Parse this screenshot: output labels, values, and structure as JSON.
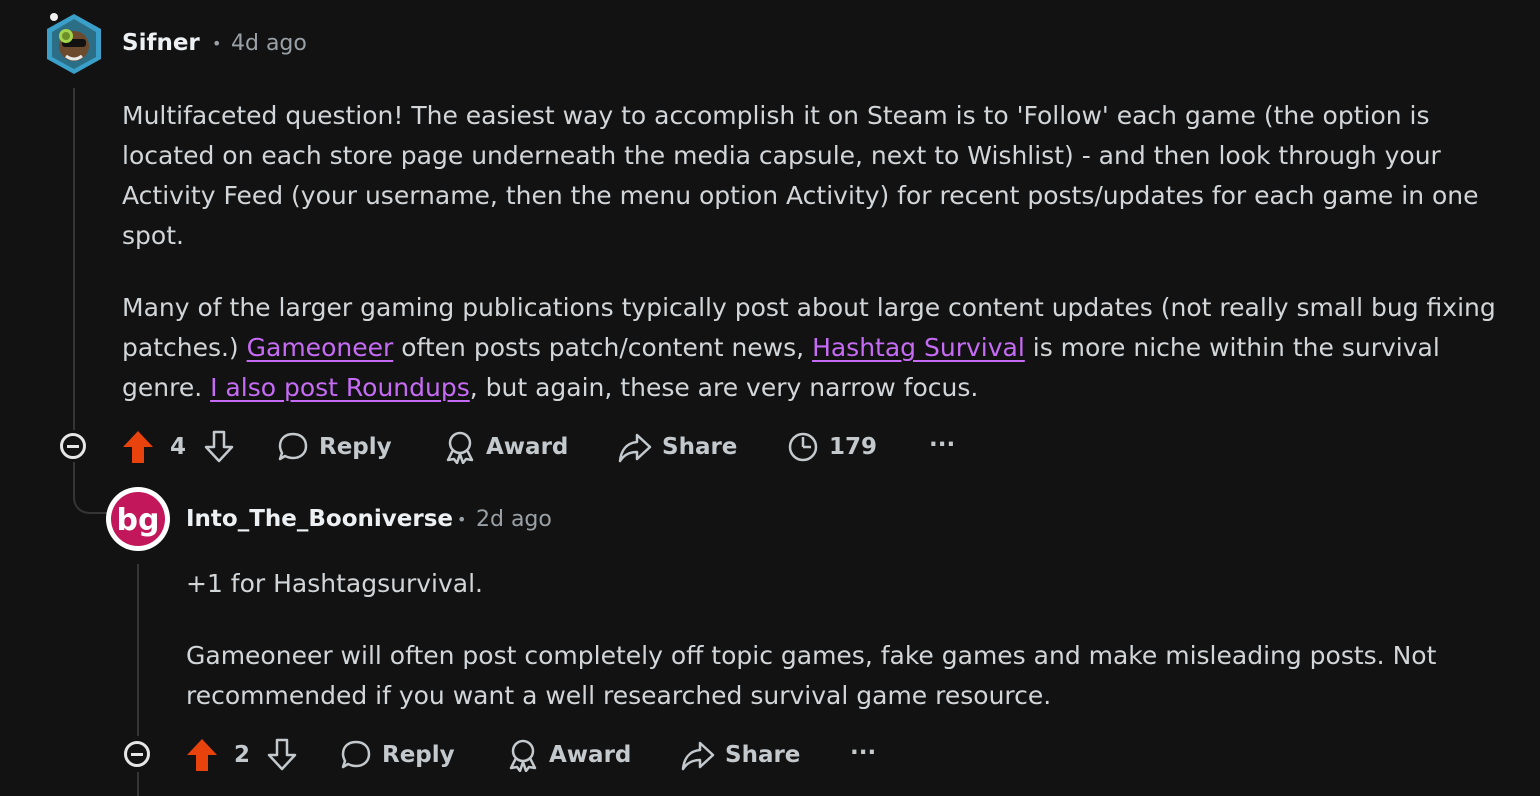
{
  "comments": [
    {
      "username": "Sifner",
      "separator": "•",
      "time": "4d ago",
      "paragraphs": [
        {
          "text": "Multifaceted question! The easiest way to accomplish it on Steam is to 'Follow' each game (the option is located on each store page underneath the media capsule, next to Wishlist) - and then look through your Activity Feed (your username, then the menu option Activity) for recent posts/updates for each game in one spot."
        },
        {
          "t1": "Many of the larger gaming publications typically post about large content updates (not really small bug fixing patches.) ",
          "link1": "Gameoneer",
          "t2": " often posts patch/content news, ",
          "link2": "Hashtag Survival",
          "t3": " is more niche within the survival genre. ",
          "link3": "I also post Roundups",
          "t4": ", but again, these are very narrow focus."
        }
      ],
      "votes": "4",
      "reply_label": "Reply",
      "award_label": "Award",
      "share_label": "Share",
      "views": "179",
      "more_label": "···"
    },
    {
      "username": "Into_The_Booniverse",
      "separator": "•",
      "time": "2d ago",
      "avatar_text": "bg",
      "paragraphs": [
        {
          "text": "+1 for Hashtagsurvival."
        },
        {
          "text": "Gameoneer will often post completely off topic games, fake games and make misleading posts. Not recommended if you want a well researched survival game resource."
        }
      ],
      "votes": "2",
      "reply_label": "Reply",
      "award_label": "Award",
      "share_label": "Share",
      "more_label": "···"
    }
  ],
  "colors": {
    "background": "#121212",
    "link": "#c66bf5",
    "upvote": "#e8430c",
    "avatar_booniverse": "#c2185b"
  },
  "icons": [
    "upvote-arrow-icon",
    "downvote-arrow-icon",
    "reply-bubble-icon",
    "award-ribbon-icon",
    "share-arrow-icon",
    "views-pie-icon",
    "more-dots-icon",
    "collapse-minus-icon"
  ]
}
